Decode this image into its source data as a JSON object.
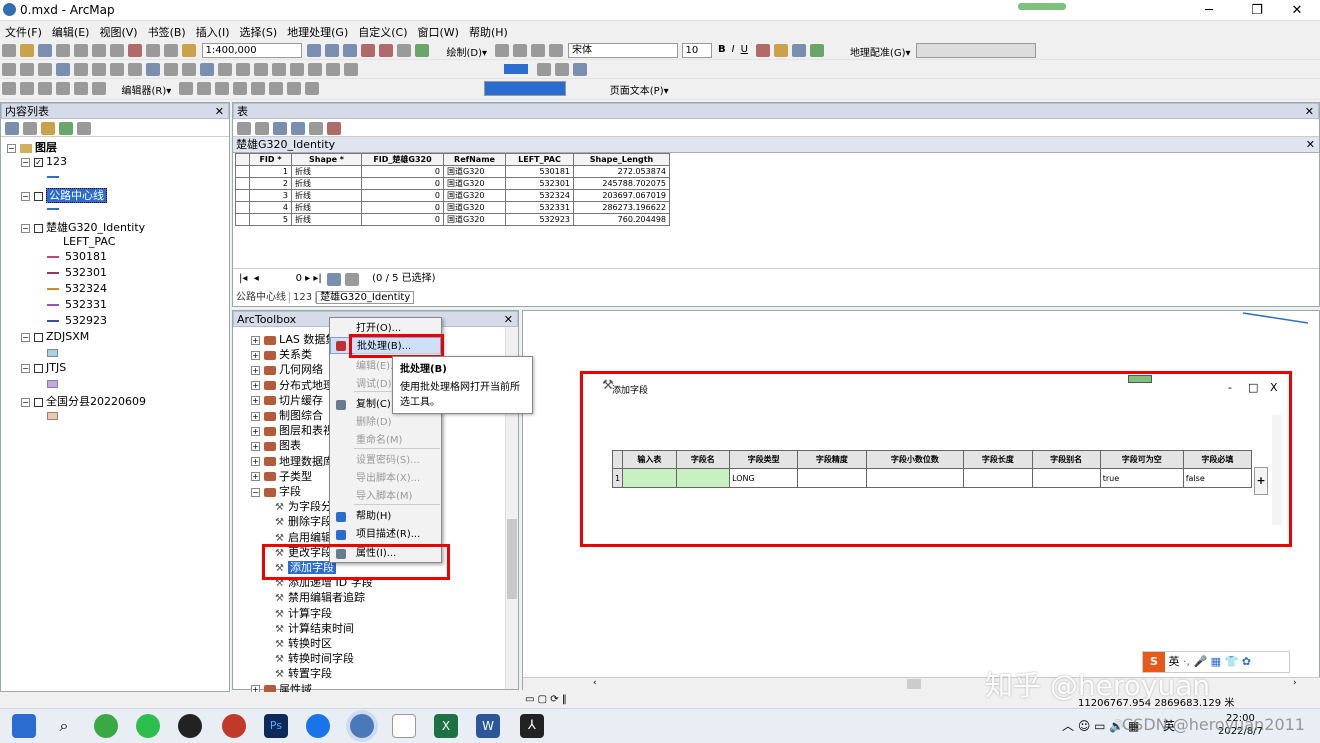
{
  "window": {
    "title": "0.mxd - ArcMap",
    "minimize": "─",
    "maximize": "❐",
    "close": "✕"
  },
  "menu": [
    "文件(F)",
    "编辑(E)",
    "视图(V)",
    "书签(B)",
    "插入(I)",
    "选择(S)",
    "地理处理(G)",
    "自定义(C)",
    "窗口(W)",
    "帮助(H)"
  ],
  "toolbar": {
    "scale": "1:400,000",
    "draw_label": "绘制(D)▾",
    "font": "宋体",
    "font_size": "10",
    "bold": "B",
    "italic": "I",
    "underline": "U",
    "geoprocessing_label": "地理配准(G)▾",
    "editor_label": "编辑器(R)▾",
    "page_text_label": "页面文本(P)▾"
  },
  "toc": {
    "title": "内容列表",
    "root": "图层",
    "layers": [
      {
        "name": "123",
        "checked": true
      },
      {
        "name": "公路中心线",
        "checked": false,
        "selected": true
      },
      {
        "name": "楚雄G320_Identity",
        "checked": false
      },
      {
        "name": "ZDJSXM",
        "checked": false
      },
      {
        "name": "JTJS",
        "checked": false
      },
      {
        "name": "全国分县20220609",
        "checked": false
      }
    ],
    "field_label": "LEFT_PAC",
    "legend": [
      {
        "code": "530181",
        "color": "#c04080"
      },
      {
        "code": "532301",
        "color": "#a0306a"
      },
      {
        "code": "532324",
        "color": "#d08a20"
      },
      {
        "code": "532331",
        "color": "#a050c0"
      },
      {
        "code": "532923",
        "color": "#3050b0"
      }
    ],
    "colors": {
      "line_123": "#3070c0",
      "line_hw": "#3070c0",
      "box_zd": "#a8d0e8",
      "box_jt": "#c0a8e0",
      "box_qg": "#f0c8a8"
    }
  },
  "table": {
    "title": "表",
    "tab_title": "楚雄G320_Identity",
    "columns": [
      "FID *",
      "Shape *",
      "FID_楚雄G320",
      "RefName",
      "LEFT_PAC",
      "Shape_Length"
    ],
    "rows": [
      [
        "1",
        "折线",
        "0",
        "国道G320",
        "530181",
        "272.053874"
      ],
      [
        "2",
        "折线",
        "0",
        "国道G320",
        "532301",
        "245788.702075"
      ],
      [
        "3",
        "折线",
        "0",
        "国道G320",
        "532324",
        "203697.067019"
      ],
      [
        "4",
        "折线",
        "0",
        "国道G320",
        "532331",
        "286273.196622"
      ],
      [
        "5",
        "折线",
        "0",
        "国道G320",
        "532923",
        "760.204498"
      ]
    ],
    "record_num": "0",
    "selection_status": "(0 / 5 已选择)",
    "bottom_tabs": [
      "公路中心线",
      "123",
      "楚雄G320_Identity"
    ]
  },
  "toolbox": {
    "title": "ArcToolbox",
    "items": [
      {
        "label": "LAS 数据集",
        "level": 0
      },
      {
        "label": "关系类",
        "level": 0
      },
      {
        "label": "几何网络",
        "level": 0
      },
      {
        "label": "分布式地理",
        "level": 0
      },
      {
        "label": "切片缓存",
        "level": 0
      },
      {
        "label": "制图综合",
        "level": 0
      },
      {
        "label": "图层和表视",
        "level": 0
      },
      {
        "label": "图表",
        "level": 0
      },
      {
        "label": "地理数据库",
        "level": 0
      },
      {
        "label": "子类型",
        "level": 0
      },
      {
        "label": "字段",
        "level": 0,
        "expanded": true
      },
      {
        "label": "为字段分",
        "level": 1
      },
      {
        "label": "删除字段",
        "level": 1
      },
      {
        "label": "启用编辑",
        "level": 1
      },
      {
        "label": "更改字段",
        "level": 1
      },
      {
        "label": "添加字段",
        "level": 1,
        "selected": true
      },
      {
        "label": "添加递增 ID 字段",
        "level": 1
      },
      {
        "label": "禁用编辑者追踪",
        "level": 1
      },
      {
        "label": "计算字段",
        "level": 1
      },
      {
        "label": "计算结束时间",
        "level": 1
      },
      {
        "label": "转换时区",
        "level": 1
      },
      {
        "label": "转换时间字段",
        "level": 1
      },
      {
        "label": "转置字段",
        "level": 1
      },
      {
        "label": "属性域",
        "level": 0
      }
    ]
  },
  "context_menu": {
    "items": [
      {
        "label": "打开(O)...",
        "disabled": false
      },
      {
        "label": "批处理(B)...",
        "disabled": false,
        "highlight": true
      },
      {
        "label": "编辑(E)...",
        "disabled": true
      },
      {
        "label": "调试(D)...",
        "disabled": true
      },
      {
        "label": "复制(C)",
        "disabled": false
      },
      {
        "label": "删除(D)",
        "disabled": true
      },
      {
        "label": "重命名(M)",
        "disabled": true
      },
      {
        "label": "设置密码(S)...",
        "disabled": true
      },
      {
        "label": "导出脚本(X)...",
        "disabled": true
      },
      {
        "label": "导入脚本(M)",
        "disabled": true
      },
      {
        "label": "帮助(H)",
        "disabled": false
      },
      {
        "label": "项目描述(R)...",
        "disabled": false
      },
      {
        "label": "属性(I)...",
        "disabled": false
      }
    ]
  },
  "tooltip": {
    "title": "批处理(B)",
    "text": "使用批处理格网打开当前所选工具。"
  },
  "batch_dialog": {
    "title": "添加字段",
    "columns": [
      "输入表",
      "字段名",
      "字段类型",
      "字段精度",
      "字段小数位数",
      "字段长度",
      "字段别名",
      "字段可为空",
      "字段必填"
    ],
    "row": {
      "index": "1",
      "type": "LONG",
      "nullable": "true",
      "required": "false"
    },
    "min": "-",
    "max": "□",
    "close": "X",
    "add": "+",
    "colors": {
      "input_fill": "#c8f0c0"
    }
  },
  "status": {
    "coords": "11206767.954  2869683.129 米"
  },
  "watermark": {
    "zhihu": "知乎 @heroyuan",
    "csdn": "CSDN @heroyuan2011"
  },
  "taskbar": {
    "lang": "英",
    "time": "22:00",
    "date": "2022/8/7"
  }
}
